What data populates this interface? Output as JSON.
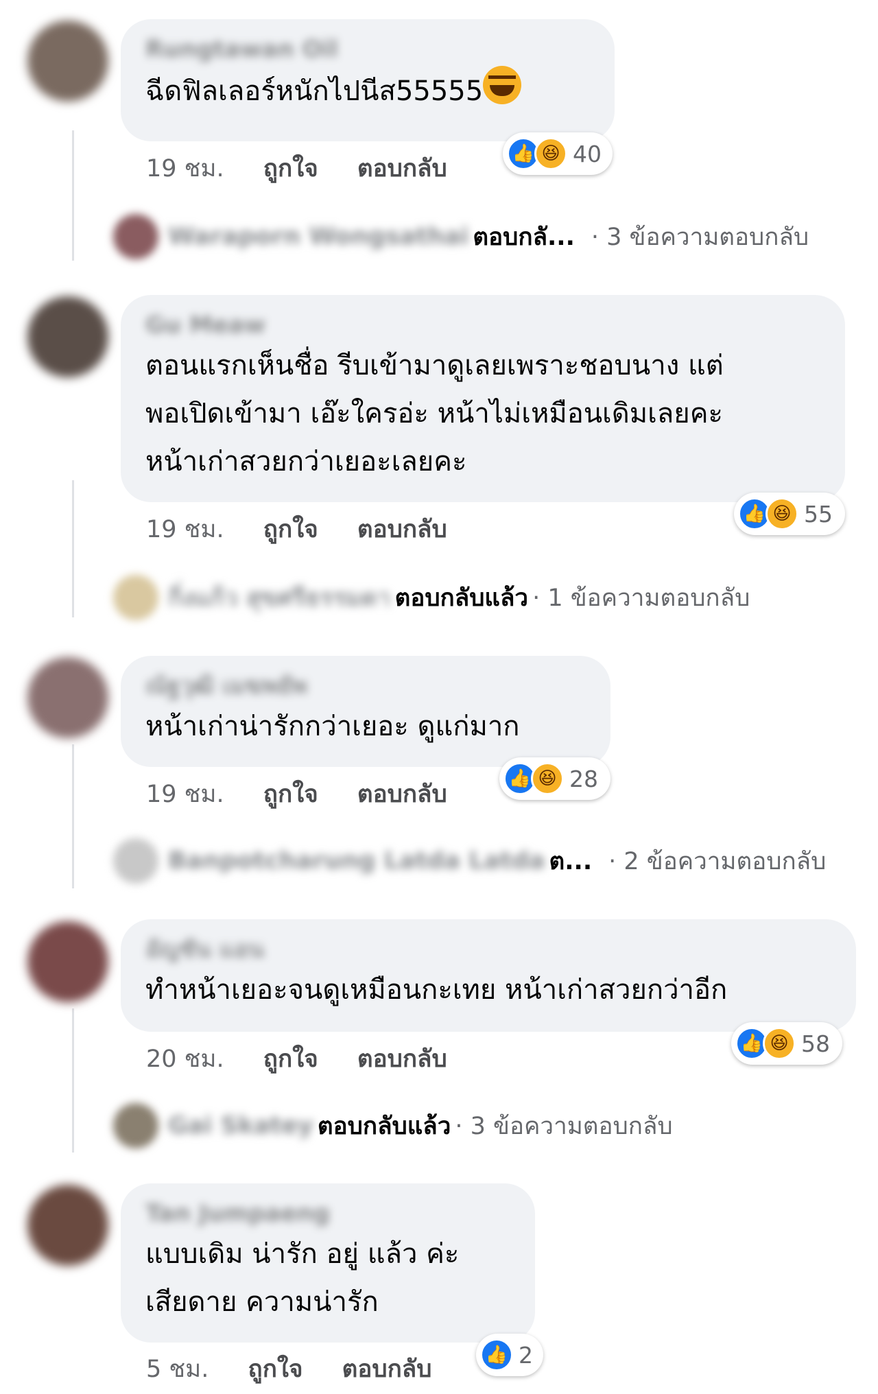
{
  "comments": [
    {
      "author": "Rungtawan Oil",
      "text": "ฉีดฟิลเลอร์หนักไปนีส55555",
      "time": "19 ชม.",
      "like_label": "ถูกใจ",
      "reply_label": "ตอบกลับ",
      "reaction_count": "40",
      "replies": {
        "name": "Waraporn Wongsathai",
        "action": "ตอบกลั...",
        "count": "· 3 ข้อความตอบกลับ"
      }
    },
    {
      "author": "Gu Meaw",
      "text": "ตอนแรกเห็นชื่อ รีบเข้ามาดูเลยเพราะชอบนาง แต่\nพอเปิดเข้ามา เอ๊ะใครอ่ะ หน้าไม่เหมือนเดิมเลยคะ\nหน้าเก่าสวยกว่าเยอะเลยคะ",
      "time": "19 ชม.",
      "like_label": "ถูกใจ",
      "reply_label": "ตอบกลับ",
      "reaction_count": "55",
      "replies": {
        "name": "กิ่งแก้ว สุขศรีธรรมดา",
        "action": "ตอบกลับแล้ว",
        "count": "· 1 ข้อความตอบกลับ"
      }
    },
    {
      "author": "ณัฐวุฒิ เมฆพยัพ",
      "text": "หน้าเก่าน่ารักกว่าเยอะ ดูแก่มาก",
      "time": "19 ชม.",
      "like_label": "ถูกใจ",
      "reply_label": "ตอบกลับ",
      "reaction_count": "28",
      "replies": {
        "name": "Banpotcharung Latda Latda",
        "action": "ต...",
        "count": "· 2 ข้อความตอบกลับ"
      }
    },
    {
      "author": "อัญชัน แอน",
      "text": "ทำหน้าเยอะจนดูเหมือนกะเทย หน้าเก่าสวยกว่าอีก",
      "time": "20 ชม.",
      "like_label": "ถูกใจ",
      "reply_label": "ตอบกลับ",
      "reaction_count": "58",
      "replies": {
        "name": "Gai Skatey",
        "action": "ตอบกลับแล้ว",
        "count": "· 3 ข้อความตอบกลับ"
      }
    },
    {
      "author": "Tan Jumpaeng",
      "text": "แบบเดิม น่ารัก อยู่ แล้ว ค่ะ\nเสียดาย ความน่ารัก",
      "time": "5 ชม.",
      "like_label": "ถูกใจ",
      "reply_label": "ตอบกลับ",
      "reaction_count": "2"
    }
  ],
  "colors": {
    "like": "#1877f2",
    "haha": "#f7b125",
    "bubble": "#f0f2f5",
    "meta": "#65676b"
  }
}
